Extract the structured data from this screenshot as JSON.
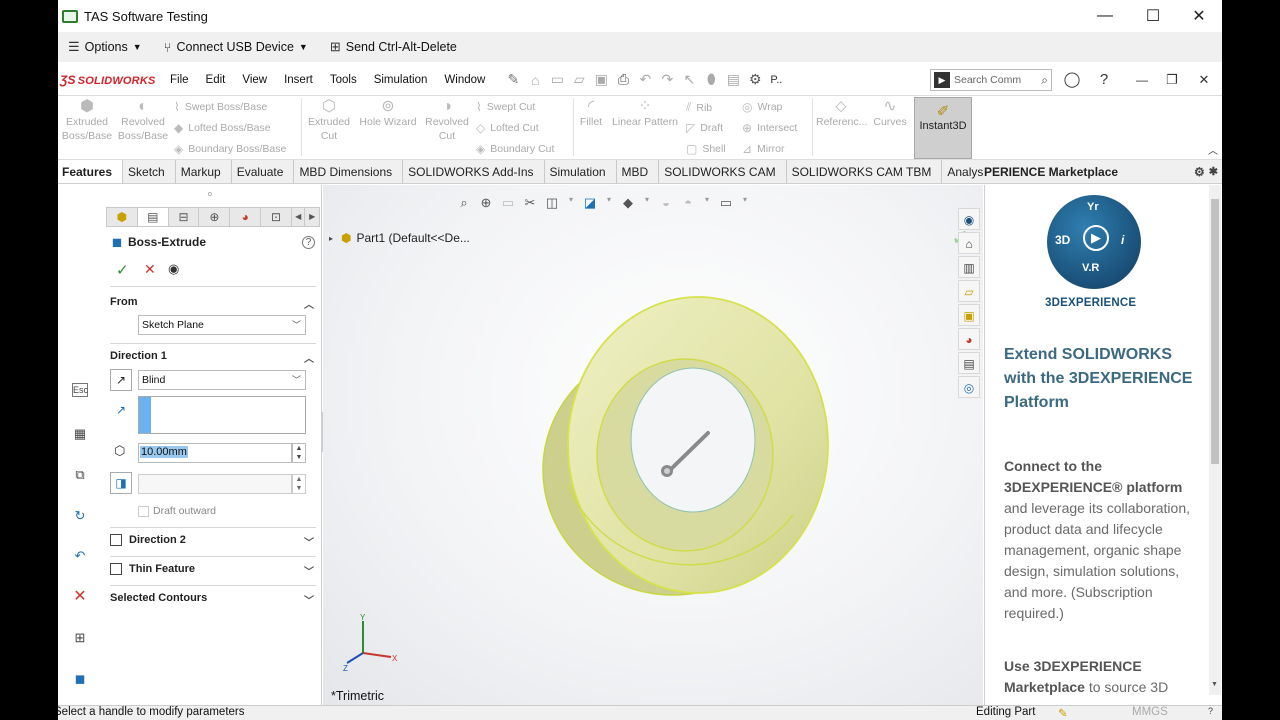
{
  "remote_window": {
    "title": "TAS Software Testing",
    "minimize": "—",
    "maximize": "☐",
    "close": "✕"
  },
  "remote_toolbar": {
    "options": "Options",
    "connect_usb": "Connect USB Device",
    "send_cad": "Send Ctrl-Alt-Delete"
  },
  "sw_menu": {
    "brand": "SOLIDWORKS",
    "items": [
      "File",
      "Edit",
      "View",
      "Insert",
      "Tools",
      "Simulation",
      "Window"
    ],
    "search_placeholder": "Search Comm",
    "p_label": "P.."
  },
  "ribbon": {
    "extruded_boss": "Extruded Boss/Base",
    "revolved_boss": "Revolved Boss/Base",
    "swept_boss": "Swept Boss/Base",
    "lofted_boss": "Lofted Boss/Base",
    "boundary_boss": "Boundary Boss/Base",
    "extruded_cut": "Extruded Cut",
    "hole_wizard": "Hole Wizard",
    "revolved_cut": "Revolved Cut",
    "swept_cut": "Swept Cut",
    "lofted_cut": "Lofted Cut",
    "boundary_cut": "Boundary Cut",
    "fillet": "Fillet",
    "linear_pattern": "Linear Pattern",
    "rib": "Rib",
    "draft": "Draft",
    "shell": "Shell",
    "wrap": "Wrap",
    "intersect": "Intersect",
    "mirror": "Mirror",
    "reference": "Referenc...",
    "curves": "Curves",
    "instant3d": "Instant3D"
  },
  "tabs": [
    "Features",
    "Sketch",
    "Markup",
    "Evaluate",
    "MBD Dimensions",
    "SOLIDWORKS Add-Ins",
    "Simulation",
    "MBD",
    "SOLIDWORKS CAM",
    "SOLIDWORKS CAM TBM",
    "Analysis Preparation"
  ],
  "task_pane_header": "PERIENCE Marketplace",
  "property_manager": {
    "title": "Boss-Extrude",
    "from_label": "From",
    "from_value": "Sketch Plane",
    "direction1_label": "Direction 1",
    "end_condition": "Blind",
    "depth": "10.00mm",
    "draft_outward": "Draft outward",
    "direction2": "Direction 2",
    "thin_feature": "Thin Feature",
    "selected_contours": "Selected Contours"
  },
  "viewport": {
    "tree_item": "Part1  (Default<<De...",
    "view_label": "*Trimetric"
  },
  "task_pane": {
    "logo_3d": "3D",
    "logo_vr": "V.R",
    "logo_text": "3DEXPERIENCE",
    "heading": "Extend SOLIDWORKS with the 3DEXPERIENCE Platform",
    "para1_bold": "Connect to the 3DEXPERIENCE® platform",
    "para1_rest": " and leverage its collaboration, product data and lifecycle management, organic shape design, simulation solutions, and more. (Subscription required.)",
    "para2_bold": "Use 3DEXPERIENCE Marketplace",
    "para2_rest": " to source 3D"
  },
  "status_bar": {
    "message": "Select a handle to modify parameters",
    "editing": "Editing Part",
    "units": "MMGS"
  }
}
